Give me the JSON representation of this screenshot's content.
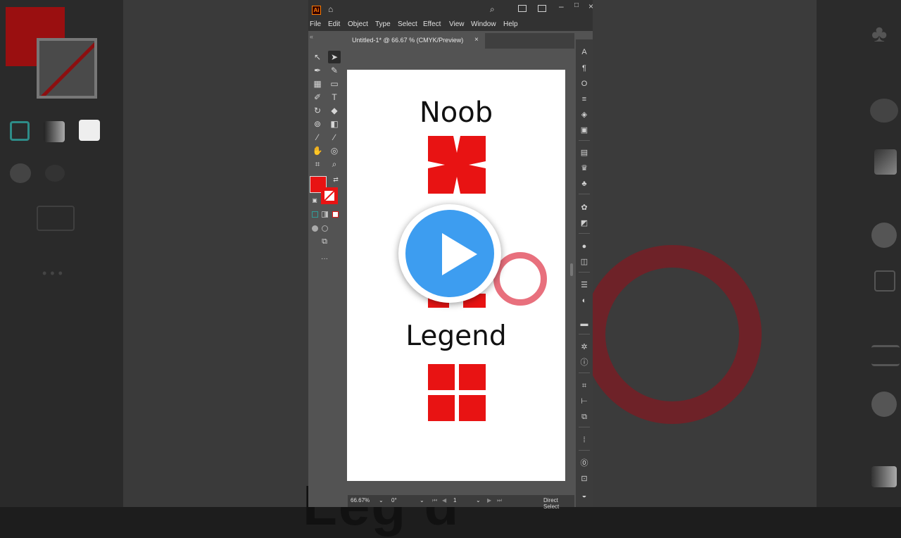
{
  "app": {
    "logo_text": "Ai",
    "menus": [
      "File",
      "Edit",
      "Object",
      "Type",
      "Select",
      "Effect",
      "View",
      "Window",
      "Help"
    ],
    "doc_tab": "Untitled-1* @ 66.67 % (CMYK/Preview)",
    "doc_tab_close": "×",
    "toolbar_grip": "«",
    "more_tools": "···"
  },
  "artboard": {
    "label_top": "Noob",
    "label_bottom": "Legend"
  },
  "background": {
    "partial_text": "Leg d"
  },
  "status": {
    "zoom": "66.67%",
    "rotation": "0°",
    "artboard_num": "1",
    "tool_name": "Direct Select"
  },
  "colors": {
    "fill": "#e81313",
    "stroke": "#e81313",
    "ring": "#e8707d",
    "play_button": "#3d9df0"
  }
}
